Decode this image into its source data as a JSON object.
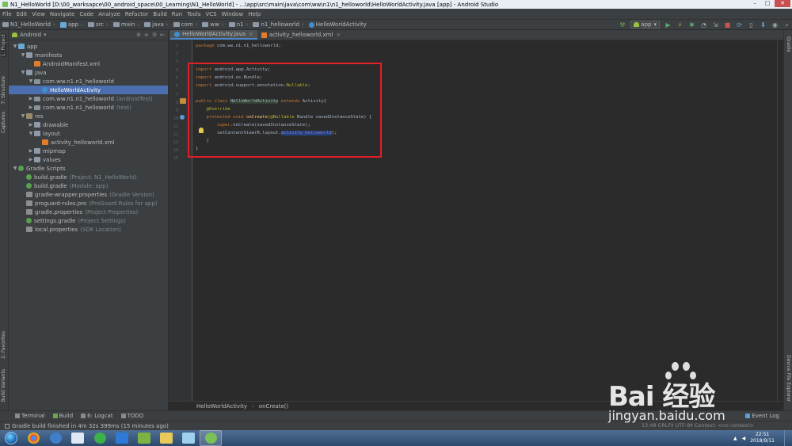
{
  "window": {
    "title": "N1_HelloWorld [D:\\00_worksapce\\00_android_space\\00_Learning\\N1_HelloWorld] - ...\\app\\src\\main\\java\\com\\ww\\n1\\n1_helloworld\\HelloWorldActivity.java [app] - Android Studio",
    "minimize": "–",
    "maximize": "□",
    "close": "✕"
  },
  "menu": [
    "File",
    "Edit",
    "View",
    "Navigate",
    "Code",
    "Analyze",
    "Refactor",
    "Build",
    "Run",
    "Tools",
    "VCS",
    "Window",
    "Help"
  ],
  "navbar": {
    "crumbs": [
      "N1_HelloWorld",
      "app",
      "src",
      "main",
      "java",
      "com",
      "ww",
      "n1",
      "n1_helloworld",
      "HelloWorldActivity"
    ],
    "run_config": "app"
  },
  "project_panel": {
    "view_mode": "Android",
    "tree": [
      {
        "depth": 0,
        "expanded": true,
        "icon": "app",
        "label": "app",
        "hint": ""
      },
      {
        "depth": 1,
        "expanded": true,
        "icon": "folder",
        "label": "manifests",
        "hint": ""
      },
      {
        "depth": 2,
        "expanded": null,
        "icon": "xml",
        "label": "AndroidManifest.xml",
        "hint": ""
      },
      {
        "depth": 1,
        "expanded": true,
        "icon": "folder",
        "label": "java",
        "hint": ""
      },
      {
        "depth": 2,
        "expanded": true,
        "icon": "pkg",
        "label": "com.ww.n1.n1_helloworld",
        "hint": ""
      },
      {
        "depth": 3,
        "expanded": null,
        "icon": "cls",
        "label": "HelloWorldActivity",
        "hint": "",
        "selected": true
      },
      {
        "depth": 2,
        "expanded": false,
        "icon": "pkg",
        "label": "com.ww.n1.n1_helloworld",
        "hint": "(androidTest)"
      },
      {
        "depth": 2,
        "expanded": false,
        "icon": "pkg",
        "label": "com.ww.n1.n1_helloworld",
        "hint": "(test)"
      },
      {
        "depth": 1,
        "expanded": true,
        "icon": "res",
        "label": "res",
        "hint": ""
      },
      {
        "depth": 2,
        "expanded": false,
        "icon": "folder",
        "label": "drawable",
        "hint": ""
      },
      {
        "depth": 2,
        "expanded": true,
        "icon": "folder",
        "label": "layout",
        "hint": ""
      },
      {
        "depth": 3,
        "expanded": null,
        "icon": "xml",
        "label": "activity_helloworld.xml",
        "hint": ""
      },
      {
        "depth": 2,
        "expanded": false,
        "icon": "folder",
        "label": "mipmap",
        "hint": ""
      },
      {
        "depth": 2,
        "expanded": false,
        "icon": "folder",
        "label": "values",
        "hint": ""
      },
      {
        "depth": 0,
        "expanded": true,
        "icon": "gradle",
        "label": "Gradle Scripts",
        "hint": ""
      },
      {
        "depth": 1,
        "expanded": null,
        "icon": "gradle",
        "label": "build.gradle",
        "hint": "(Project: N1_HelloWorld)"
      },
      {
        "depth": 1,
        "expanded": null,
        "icon": "gradle",
        "label": "build.gradle",
        "hint": "(Module: app)"
      },
      {
        "depth": 1,
        "expanded": null,
        "icon": "prop",
        "label": "gradle-wrapper.properties",
        "hint": "(Gradle Version)"
      },
      {
        "depth": 1,
        "expanded": null,
        "icon": "prop",
        "label": "proguard-rules.pro",
        "hint": "(ProGuard Rules for app)"
      },
      {
        "depth": 1,
        "expanded": null,
        "icon": "prop",
        "label": "gradle.properties",
        "hint": "(Project Properties)"
      },
      {
        "depth": 1,
        "expanded": null,
        "icon": "gradle",
        "label": "settings.gradle",
        "hint": "(Project Settings)"
      },
      {
        "depth": 1,
        "expanded": null,
        "icon": "prop",
        "label": "local.properties",
        "hint": "(SDK Location)"
      }
    ]
  },
  "left_tool_windows": {
    "project": "1: Project",
    "structure": "7: Structure",
    "captures": "Captures",
    "favorites": "2: Favorites",
    "build_variants": "Build Variants"
  },
  "right_tool_windows": {
    "gradle": "Gradle",
    "device_explorer": "Device File Explorer"
  },
  "editor": {
    "tabs": [
      {
        "label": "HelloWorldActivity.java",
        "kind": "java",
        "active": true
      },
      {
        "label": "activity_helloworld.xml",
        "kind": "xml",
        "active": false
      }
    ],
    "line_numbers": [
      "1",
      "2",
      "3",
      "4",
      "5",
      "6",
      "7",
      "8",
      "9",
      "10",
      "11",
      "12",
      "13",
      "14",
      "15"
    ],
    "code": {
      "l1_kw": "package",
      "l1_rest": " com.ww.n1.n1_helloworld;",
      "l4_kw": "import",
      "l4_rest": " android.app.Activity;",
      "l5_kw": "import",
      "l5_rest": " android.os.Bundle;",
      "l6_kw": "import",
      "l6_rest": " android.support.annotation.",
      "l6_an": "Nullable",
      "l6_end": ";",
      "l8_kw": "public class",
      "l8_hl": "HelloWorldActivity",
      "l8_kw2": " extends",
      "l8_rest": " Activity{",
      "l9_an": "@Override",
      "l10_kw": "protected void",
      "l10_fn": " onCreate",
      "l10_an": "(@Nullable",
      "l10_rest": " Bundle savedInstanceState) {",
      "l11_kw": "super",
      "l11_rest": ".onCreate(savedInstanceState);",
      "l12_rest": "setContentView(R.layout.",
      "l12_hl": "activity_helloworld",
      "l12_end": ");",
      "l13_rest": "}",
      "l14_rest": "}"
    },
    "breadcrumb": [
      "HelloWorldActivity",
      "onCreate()"
    ]
  },
  "bottom_tool_windows": {
    "tabs": [
      "Terminal",
      "Build",
      "6: Logcat",
      "TODO"
    ],
    "event_log": "Event Log"
  },
  "status": {
    "message": "Gradle build finished in 4m 32s 399ms (15 minutes ago)",
    "right": "13:48  CRLF‡  UTF-8‡  Context: <no context>"
  },
  "taskbar": {
    "time": "22:51",
    "date": "2018/9/11"
  },
  "watermark": {
    "brand": "Bai  经验",
    "url": "jingyan.baidu.com"
  },
  "colors": {
    "accent": "#4b6eaf",
    "annotation_box": "#e02027",
    "keyword": "#cc7832",
    "annotation": "#bbb529"
  }
}
